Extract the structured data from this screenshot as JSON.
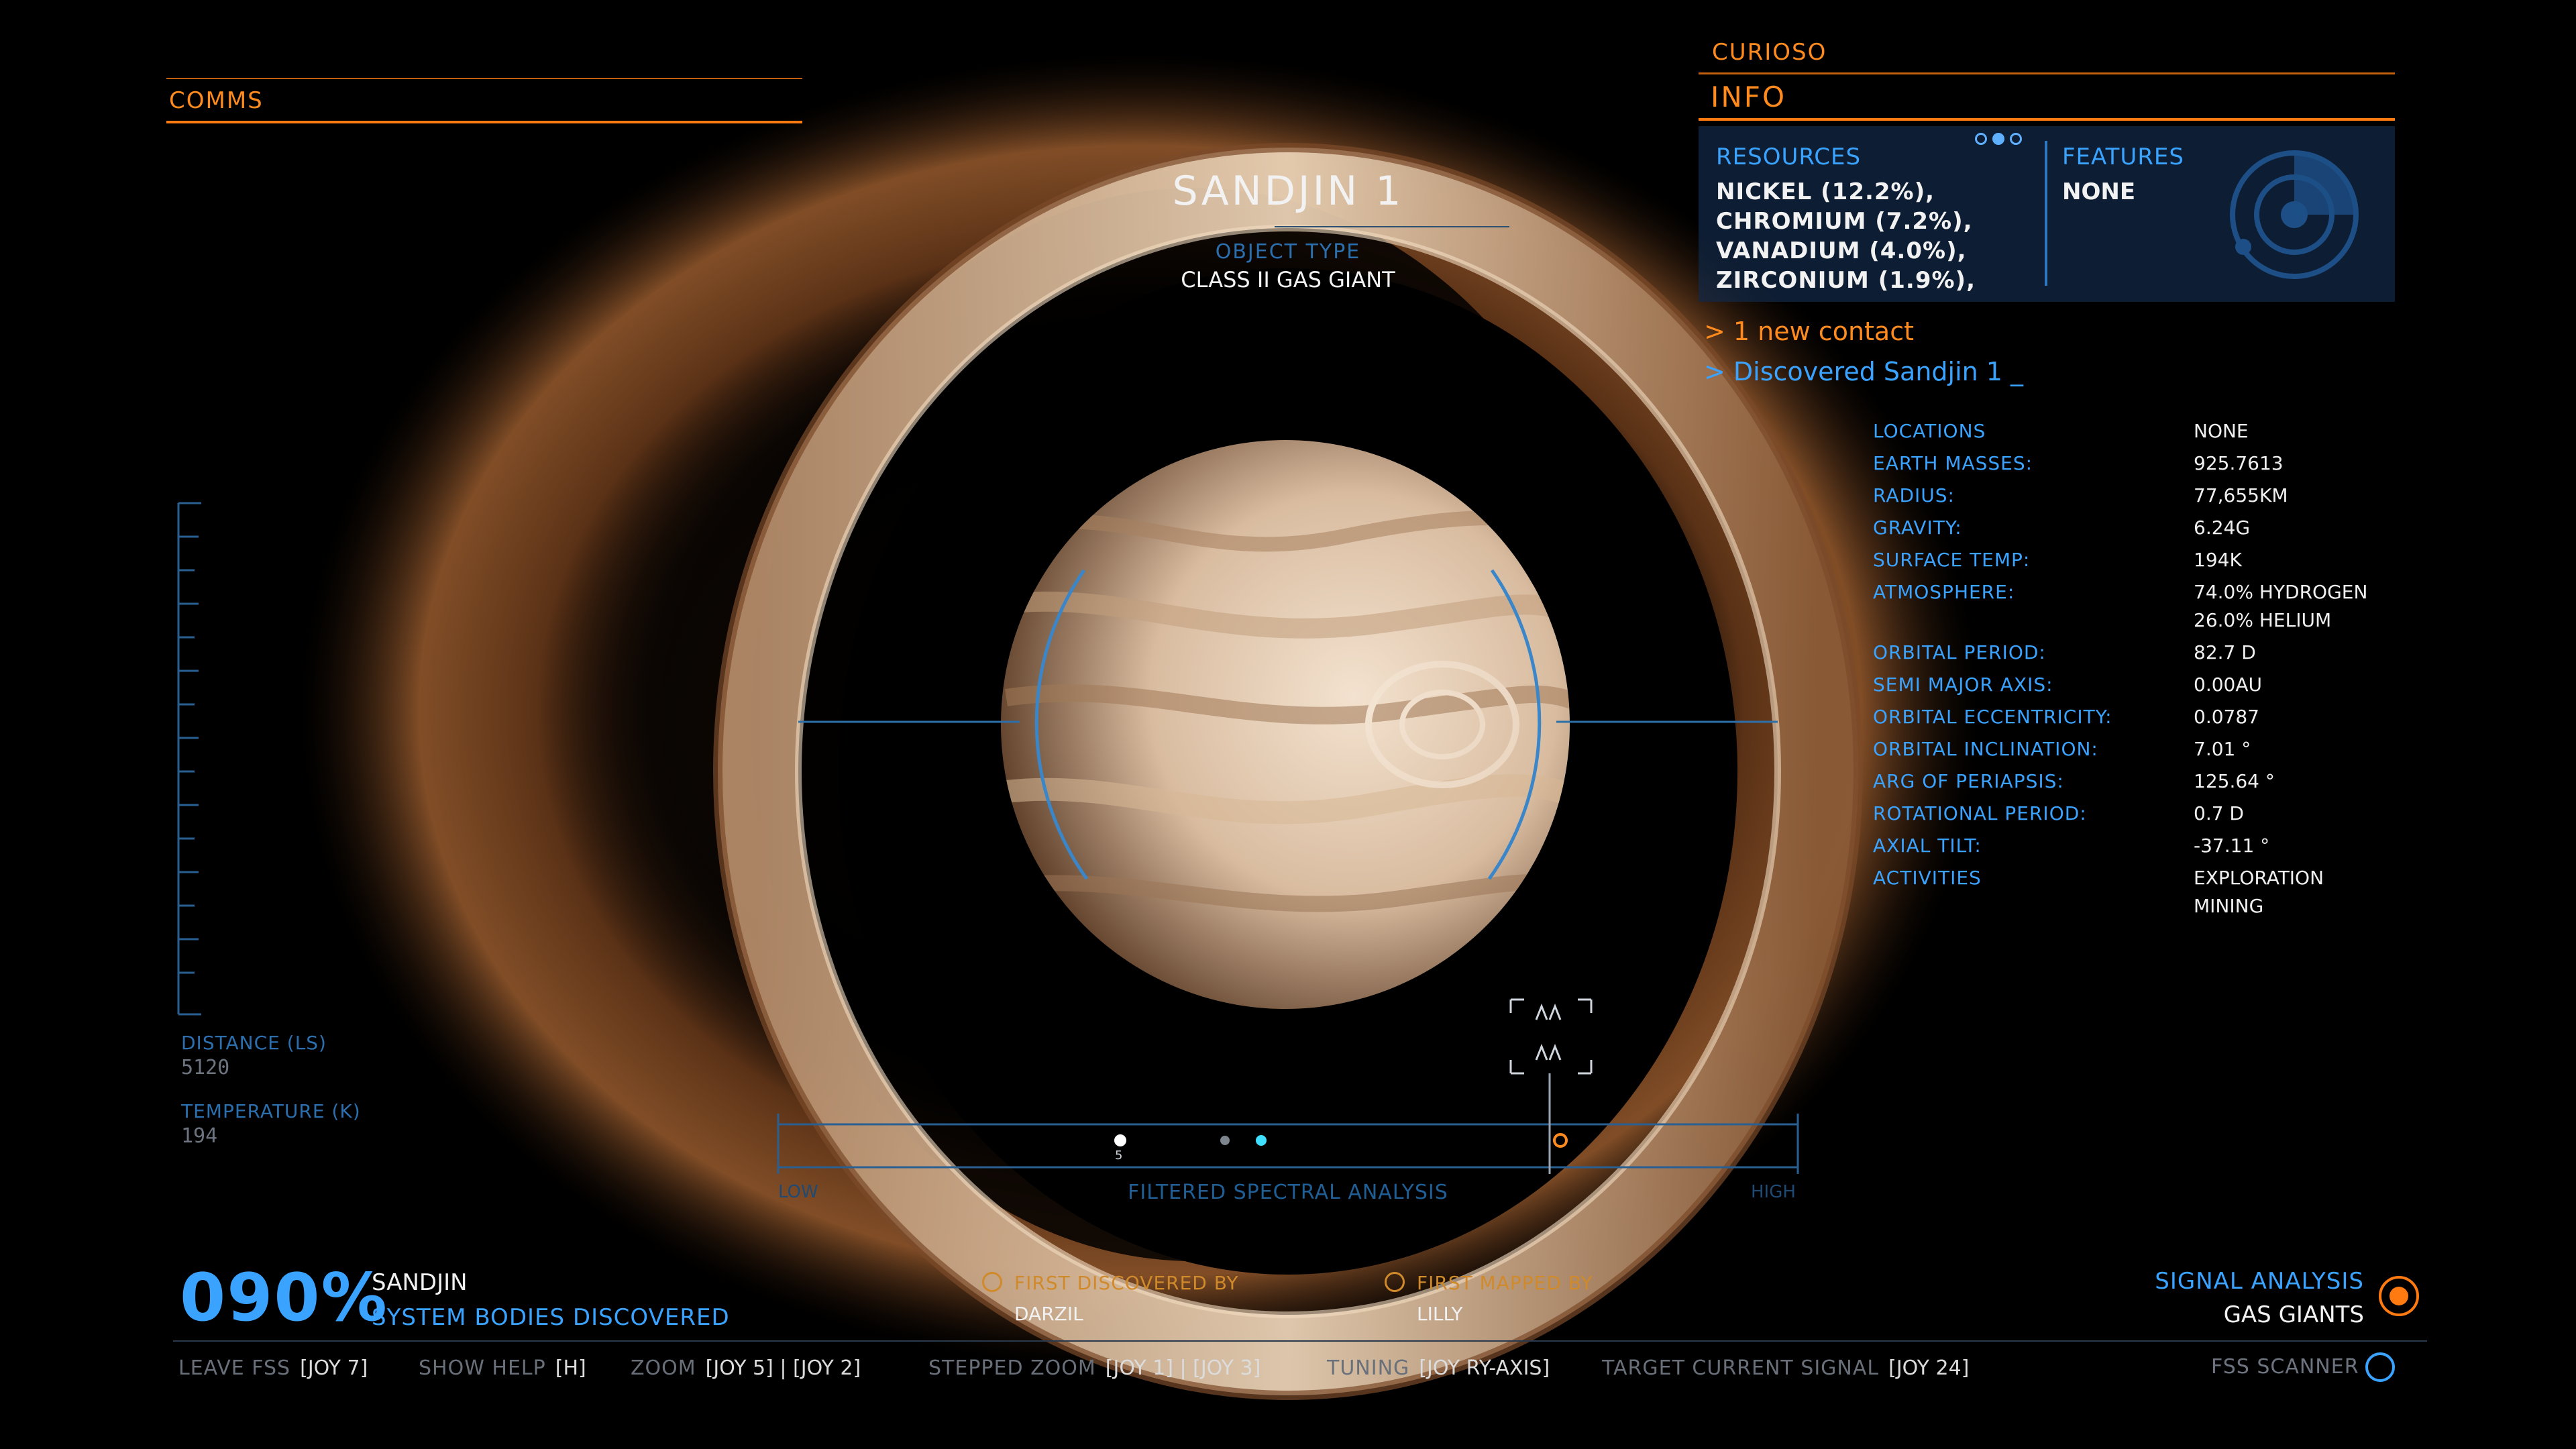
{
  "comms": {
    "label": "COMMS"
  },
  "body": {
    "name": "SANDJIN 1",
    "object_type_label": "OBJECT TYPE",
    "object_type": "CLASS II GAS GIANT"
  },
  "panel": {
    "curioso": "CURIOSO",
    "info": "INFO",
    "resources_label": "RESOURCES",
    "resources": [
      "NICKEL (12.2%),",
      "CHROMIUM (7.2%),",
      "VANADIUM (4.0%),",
      "ZIRCONIUM (1.9%),"
    ],
    "features_label": "FEATURES",
    "features_value": "NONE"
  },
  "log": {
    "contact": "> 1 new contact",
    "discovered": "> Discovered Sandjin 1 _"
  },
  "details": [
    {
      "k": "LOCATIONS",
      "v": "NONE"
    },
    {
      "k": "EARTH MASSES:",
      "v": "925.7613"
    },
    {
      "k": "RADIUS:",
      "v": "77,655KM"
    },
    {
      "k": "GRAVITY:",
      "v": "6.24G"
    },
    {
      "k": "SURFACE TEMP:",
      "v": "194K"
    },
    {
      "k": "ATMOSPHERE:",
      "v": "74.0% HYDROGEN",
      "v2": "26.0% HELIUM"
    },
    {
      "k": "ORBITAL PERIOD:",
      "v": "82.7 D"
    },
    {
      "k": "SEMI MAJOR AXIS:",
      "v": "0.00AU"
    },
    {
      "k": "ORBITAL ECCENTRICITY:",
      "v": "0.0787"
    },
    {
      "k": "ORBITAL INCLINATION:",
      "v": "7.01 °"
    },
    {
      "k": "ARG OF PERIAPSIS:",
      "v": "125.64 °"
    },
    {
      "k": "ROTATIONAL PERIOD:",
      "v": "0.7 D"
    },
    {
      "k": "AXIAL TILT:",
      "v": "-37.11 °"
    },
    {
      "k": "ACTIVITIES",
      "v": "EXPLORATION",
      "v2": "MINING"
    }
  ],
  "gauge": {
    "distance_label": "DISTANCE (LS)",
    "distance_value": "5120",
    "temperature_label": "TEMPERATURE (K)",
    "temperature_value": "194"
  },
  "spectrum": {
    "low": "LOW",
    "high": "HIGH",
    "title": "FILTERED SPECTRAL ANALYSIS",
    "marker_num": "5"
  },
  "status": {
    "percent": "090%",
    "system_name": "SANDJIN",
    "system_sub": "SYSTEM BODIES DISCOVERED",
    "first_discovered_label": "FIRST DISCOVERED BY",
    "first_discovered_value": "DARZIL",
    "first_mapped_label": "FIRST MAPPED BY",
    "first_mapped_value": "LILLY",
    "signal_label": "SIGNAL ANALYSIS",
    "signal_value": "GAS GIANTS"
  },
  "hints": [
    {
      "k": "LEAVE FSS",
      "v": "[JOY 7]"
    },
    {
      "k": "SHOW HELP",
      "v": "[H]"
    },
    {
      "k": "ZOOM",
      "v": "[JOY 5] | [JOY 2]"
    },
    {
      "k": "STEPPED ZOOM",
      "v": "[JOY 1] | [JOY 3]"
    },
    {
      "k": "TUNING",
      "v": "[JOY RY-AXIS]"
    },
    {
      "k": "TARGET CURRENT SIGNAL",
      "v": "[JOY 24]"
    }
  ],
  "fss": {
    "label": "FSS SCANNER"
  },
  "colors": {
    "orange": "#ff8a1e",
    "blue": "#3aa3ff",
    "panel": "#12284a"
  }
}
